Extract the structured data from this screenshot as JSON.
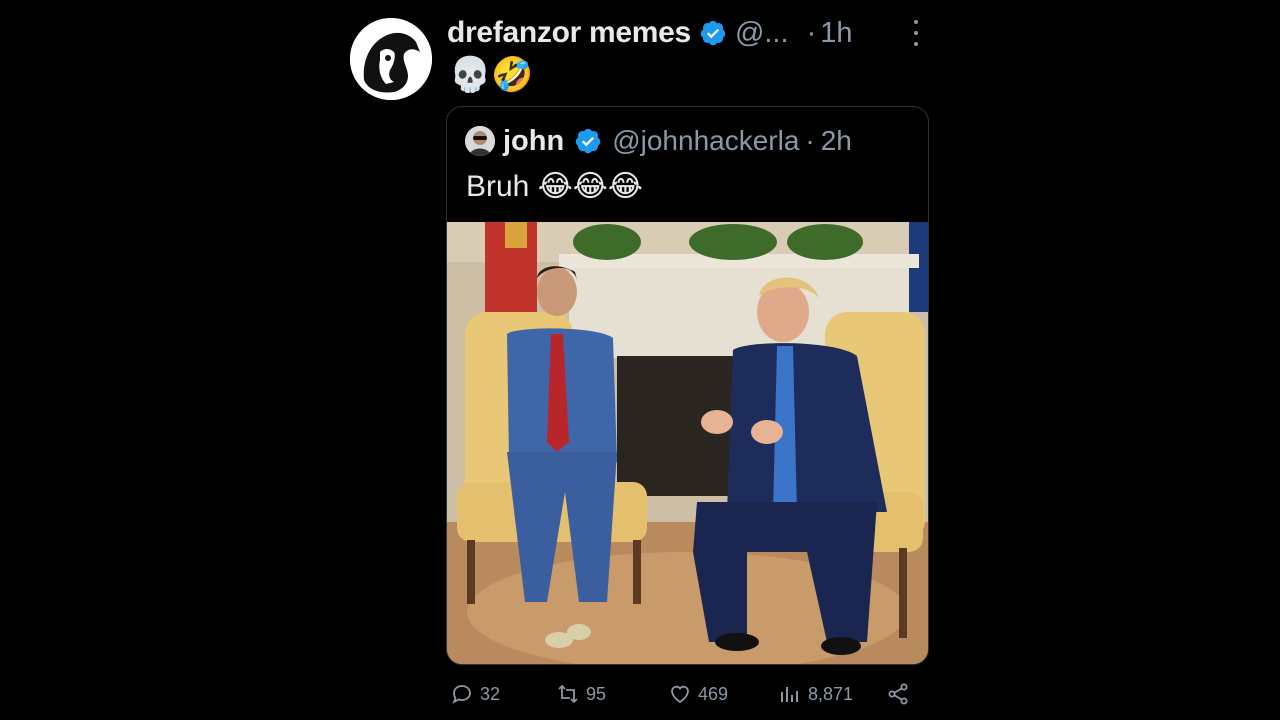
{
  "post": {
    "author_name": "drefanzor memes",
    "author_handle": "@...",
    "separator": "·",
    "time": "1h",
    "text": "💀🤣",
    "avatar": "silhouette-avatar"
  },
  "quoted": {
    "author_name": "john",
    "author_handle": "@johnhackerla",
    "separator": "·",
    "time": "2h",
    "text_prefix": "Bruh",
    "text_emoji": "😂😂😂",
    "media_alt": "Photo of two men in suits seated in yellow armchairs in front of a fireplace"
  },
  "actions": {
    "replies": "32",
    "reposts": "95",
    "likes": "469",
    "views": "8,871"
  },
  "colors": {
    "background": "#000000",
    "text": "#e7e9ea",
    "muted": "#8b98a5",
    "verified": "#1d9bf0",
    "border": "#2f3336"
  },
  "icons": [
    "more-icon",
    "verified-badge-icon",
    "reply-icon",
    "repost-icon",
    "like-icon",
    "views-icon",
    "share-icon"
  ]
}
